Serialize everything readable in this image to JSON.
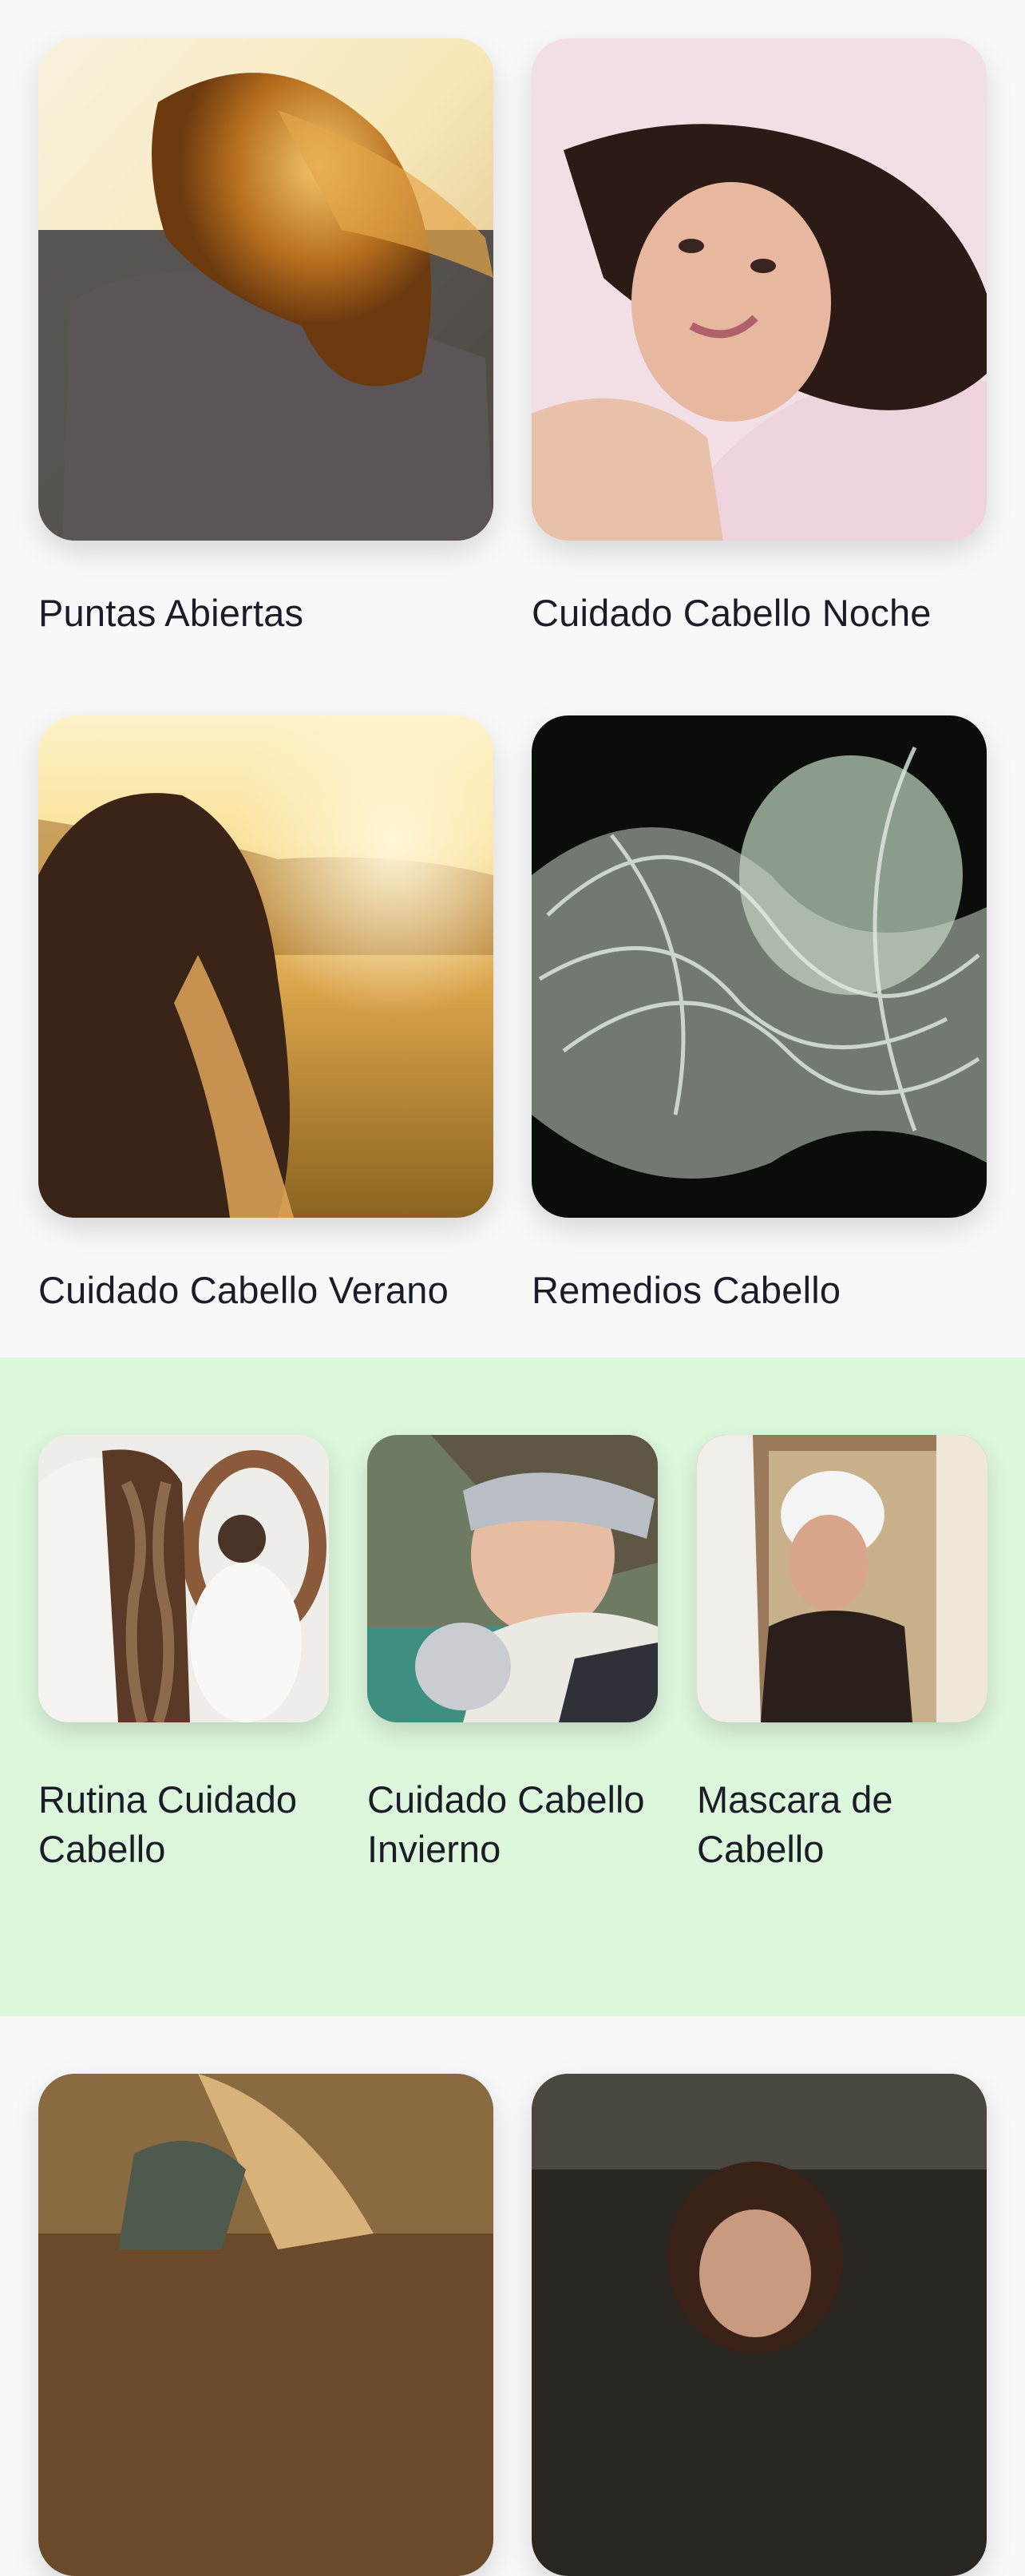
{
  "featured": [
    {
      "title": "Puntas Abiertas",
      "image": "woman-windblown-blonde-hair-photo"
    },
    {
      "title": "Cuidado Cabello Noche",
      "image": "woman-smiling-on-pillow-photo"
    },
    {
      "title": "Cuidado Cabello Verano",
      "image": "woman-in-sunset-field-photo"
    },
    {
      "title": "Remedios Cabello",
      "image": "woman-flowing-hair-monochrome-photo"
    }
  ],
  "collection": {
    "background": "#ddf7dd",
    "items": [
      {
        "title": "Rutina Cuidado Cabello",
        "image": "braided-hair-mirror-photo"
      },
      {
        "title": "Cuidado Cabello Invierno",
        "image": "woman-headband-winter-photo"
      },
      {
        "title": "Mascara de Cabello",
        "image": "woman-towel-mirror-photo"
      }
    ]
  },
  "more": [
    {
      "title": "",
      "image": "woman-knit-sweater-photo"
    },
    {
      "title": "",
      "image": "woman-dark-forest-photo"
    }
  ]
}
